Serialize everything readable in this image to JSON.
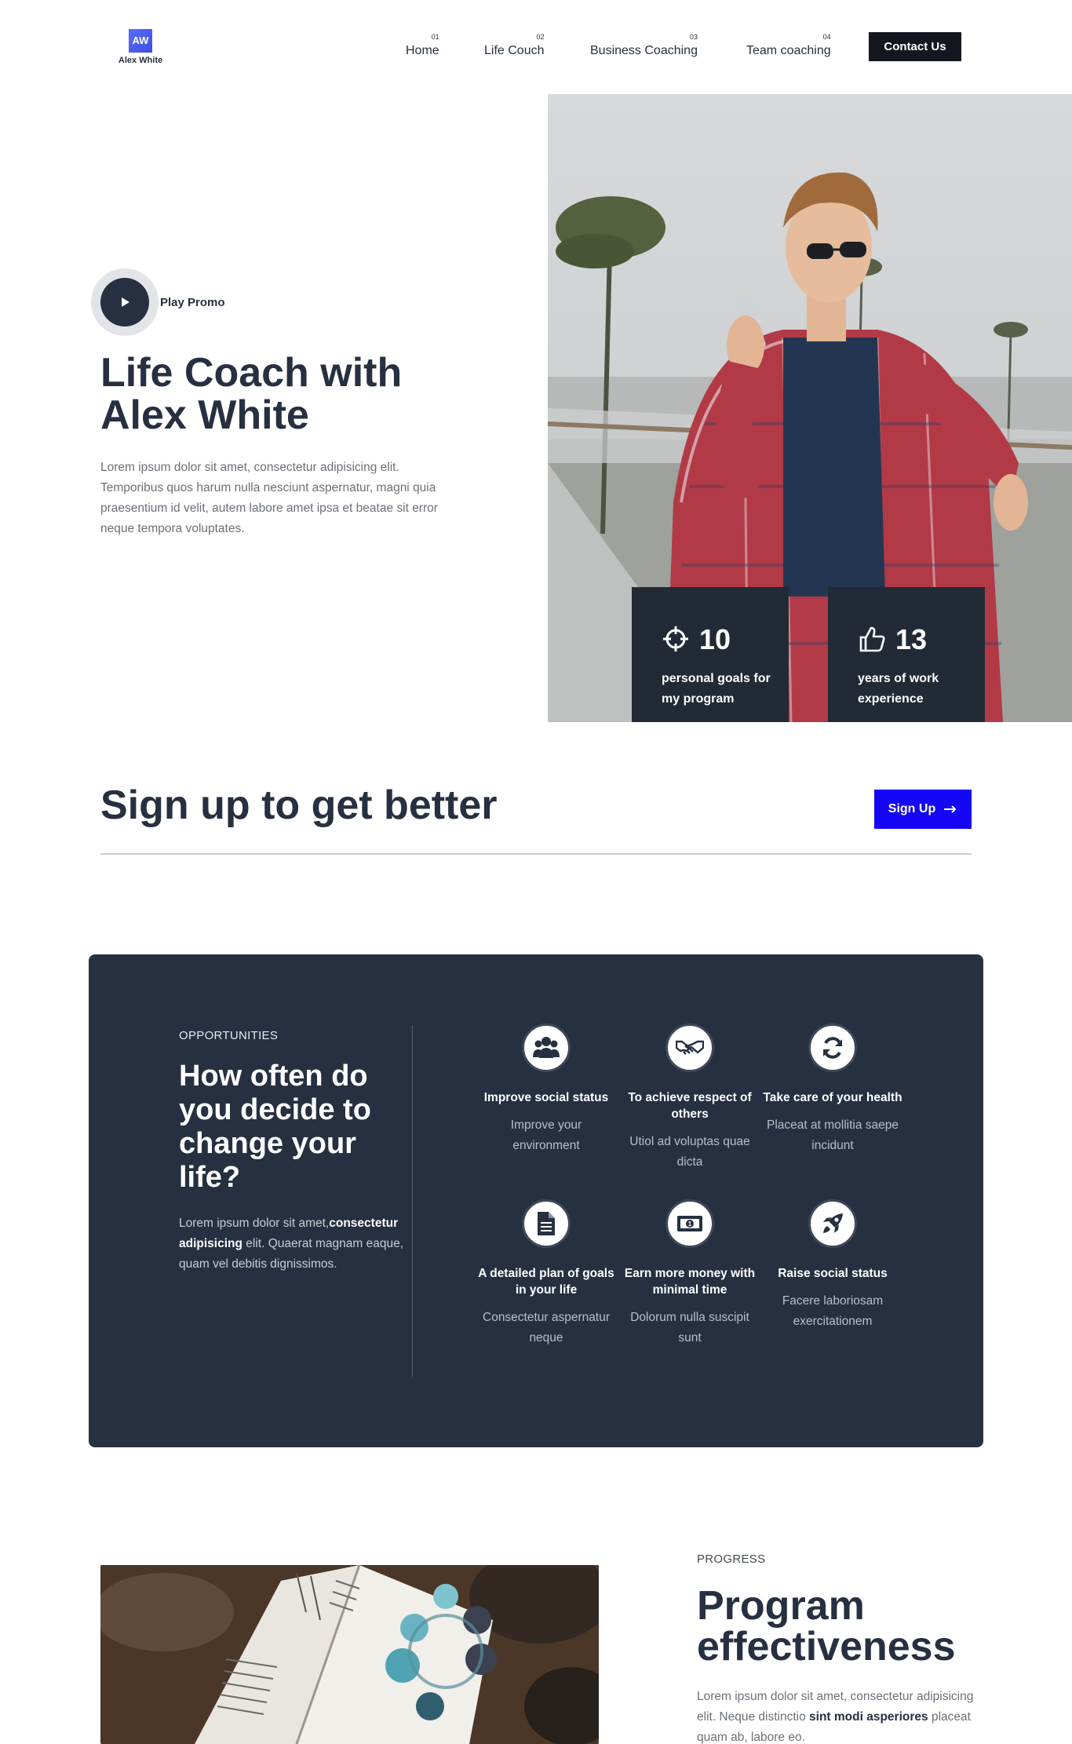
{
  "brand": {
    "badge": "AW",
    "name": "Alex White",
    "badge_color": "#4b5cf0"
  },
  "nav": {
    "items": [
      {
        "num": "01",
        "label": "Home"
      },
      {
        "num": "02",
        "label": "Life Couch"
      },
      {
        "num": "03",
        "label": "Business Coaching"
      },
      {
        "num": "04",
        "label": "Team coaching"
      }
    ],
    "contact_label": "Contact Us"
  },
  "hero": {
    "play_label": "Play Promo",
    "title_line1": "Life Coach with",
    "title_line2": "Alex White",
    "description": "Lorem ipsum dolor sit amet, consectetur adipisicing elit. Temporibus quos harum nulla nesciunt aspernatur, magni quia praesentium id velit, autem labore amet ipsa et beatae sit error neque tempora voluptates.",
    "stats": [
      {
        "icon": "crosshair-icon",
        "value": "10",
        "label": "personal goals for my program"
      },
      {
        "icon": "thumbs-up-icon",
        "value": "13",
        "label": "years of work experience"
      }
    ]
  },
  "signup": {
    "title": "Sign up to get better",
    "button_label": "Sign Up",
    "button_color": "#1506f5"
  },
  "opportunities": {
    "eyebrow": "OPPORTUNITIES",
    "title": "How often do you decide to change your life?",
    "desc_part1": "Lorem ipsum dolor sit amet,",
    "desc_bold": "consectetur adipisicing",
    "desc_part2": " elit. Quaerat magnam eaque, quam vel debitis dignissimos.",
    "features": [
      {
        "icon": "users-icon",
        "title": "Improve social status",
        "text": "Improve your environment"
      },
      {
        "icon": "handshake-icon",
        "title": "To achieve respect of others",
        "text": "Utiol ad voluptas quae dicta"
      },
      {
        "icon": "refresh-icon",
        "title": "Take care of your health",
        "text": "Placeat at mollitia saepe incidunt"
      },
      {
        "icon": "document-icon",
        "title": "A detailed plan of goals in your life",
        "text": "Consectetur aspernatur neque"
      },
      {
        "icon": "money-icon",
        "title": "Earn more money with minimal time",
        "text": "Dolorum nulla suscipit sunt"
      },
      {
        "icon": "rocket-icon",
        "title": "Raise social status",
        "text": "Facere laboriosam exercitationem"
      }
    ]
  },
  "progress": {
    "eyebrow": "PROGRESS",
    "title_line1": "Program",
    "title_line2": "effectiveness",
    "desc_part1": "Lorem ipsum dolor sit amet, consectetur adipisicing elit. Neque distinctio ",
    "desc_bold": "sint modi asperiores",
    "desc_part2": " placeat quam ab, labore eo."
  }
}
